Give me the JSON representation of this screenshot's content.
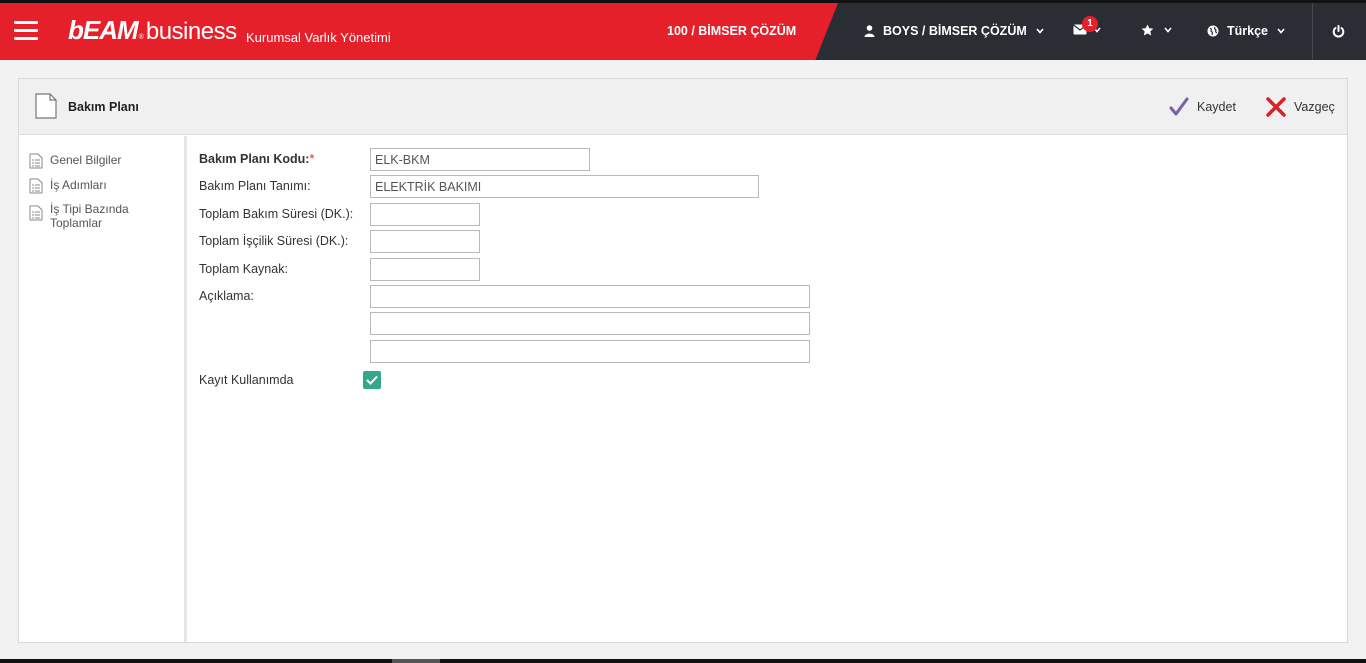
{
  "header": {
    "logo_bold": "bEAM",
    "logo_light": "business",
    "logo_reg": "®",
    "app_subtitle": "Kurumsal Varlık Yönetimi",
    "company": "100 / BİMSER ÇÖZÜM",
    "user": "BOYS / BİMSER ÇÖZÜM",
    "message_count": "1",
    "language": "Türkçe",
    "colors": {
      "brand_red": "#e5202a",
      "dark_bar": "#2b2d35"
    },
    "icons": [
      "menu-icon",
      "user-icon",
      "envelope-icon",
      "star-icon",
      "globe-icon",
      "power-icon",
      "chevron-down-icon"
    ]
  },
  "page": {
    "title": "Bakım Planı",
    "save_label": "Kaydet",
    "cancel_label": "Vazgeç"
  },
  "sidebar": {
    "items": [
      {
        "label": "Genel Bilgiler"
      },
      {
        "label": "İş Adımları"
      },
      {
        "label": "İş Tipi Bazında Toplamlar"
      }
    ]
  },
  "form": {
    "code_label": "Bakım Planı Kodu:",
    "code_required": "*",
    "code_value": "ELK-BKM",
    "definition_label": "Bakım Planı Tanımı:",
    "definition_value": "ELEKTRİK BAKIMI",
    "total_maint_label": "Toplam Bakım Süresi (DK.):",
    "total_maint_value": "",
    "total_labor_label": "Toplam İşçilik Süresi (DK.):",
    "total_labor_value": "",
    "total_resource_label": "Toplam Kaynak:",
    "total_resource_value": "",
    "description_label": "Açıklama:",
    "description_lines": [
      "",
      "",
      ""
    ],
    "active_label": "Kayıt Kullanımda",
    "active_checked": true,
    "checkbox_color": "#35a88c"
  }
}
